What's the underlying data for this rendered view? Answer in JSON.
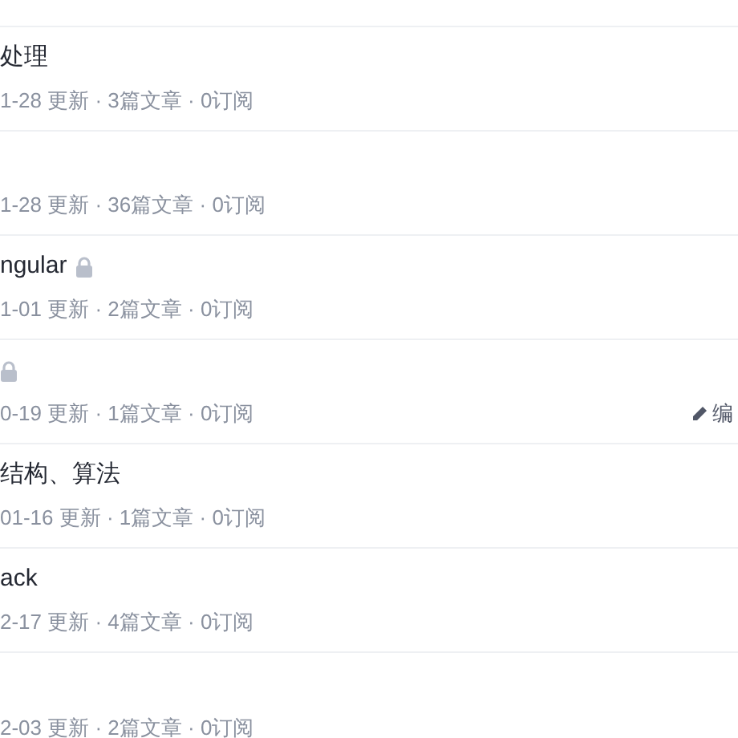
{
  "columns": [
    {
      "title": "处理",
      "meta": "1-28 更新 · 3篇文章 · 0订阅",
      "locked": false
    },
    {
      "meta": "1-28 更新 · 36篇文章 · 0订阅",
      "locked": false
    },
    {
      "title": "ngular",
      "meta": "1-01 更新 · 2篇文章 · 0订阅",
      "locked": true
    },
    {
      "meta": "0-19 更新 · 1篇文章 · 0订阅",
      "locked": true,
      "edit": "编"
    },
    {
      "title": "结构、算法",
      "meta": "01-16 更新 · 1篇文章 · 0订阅",
      "locked": false
    },
    {
      "title": "ack",
      "meta": "2-17 更新 · 4篇文章 · 0订阅",
      "locked": false
    },
    {
      "meta": "2-03 更新 · 2篇文章 · 0订阅",
      "locked": false
    }
  ]
}
